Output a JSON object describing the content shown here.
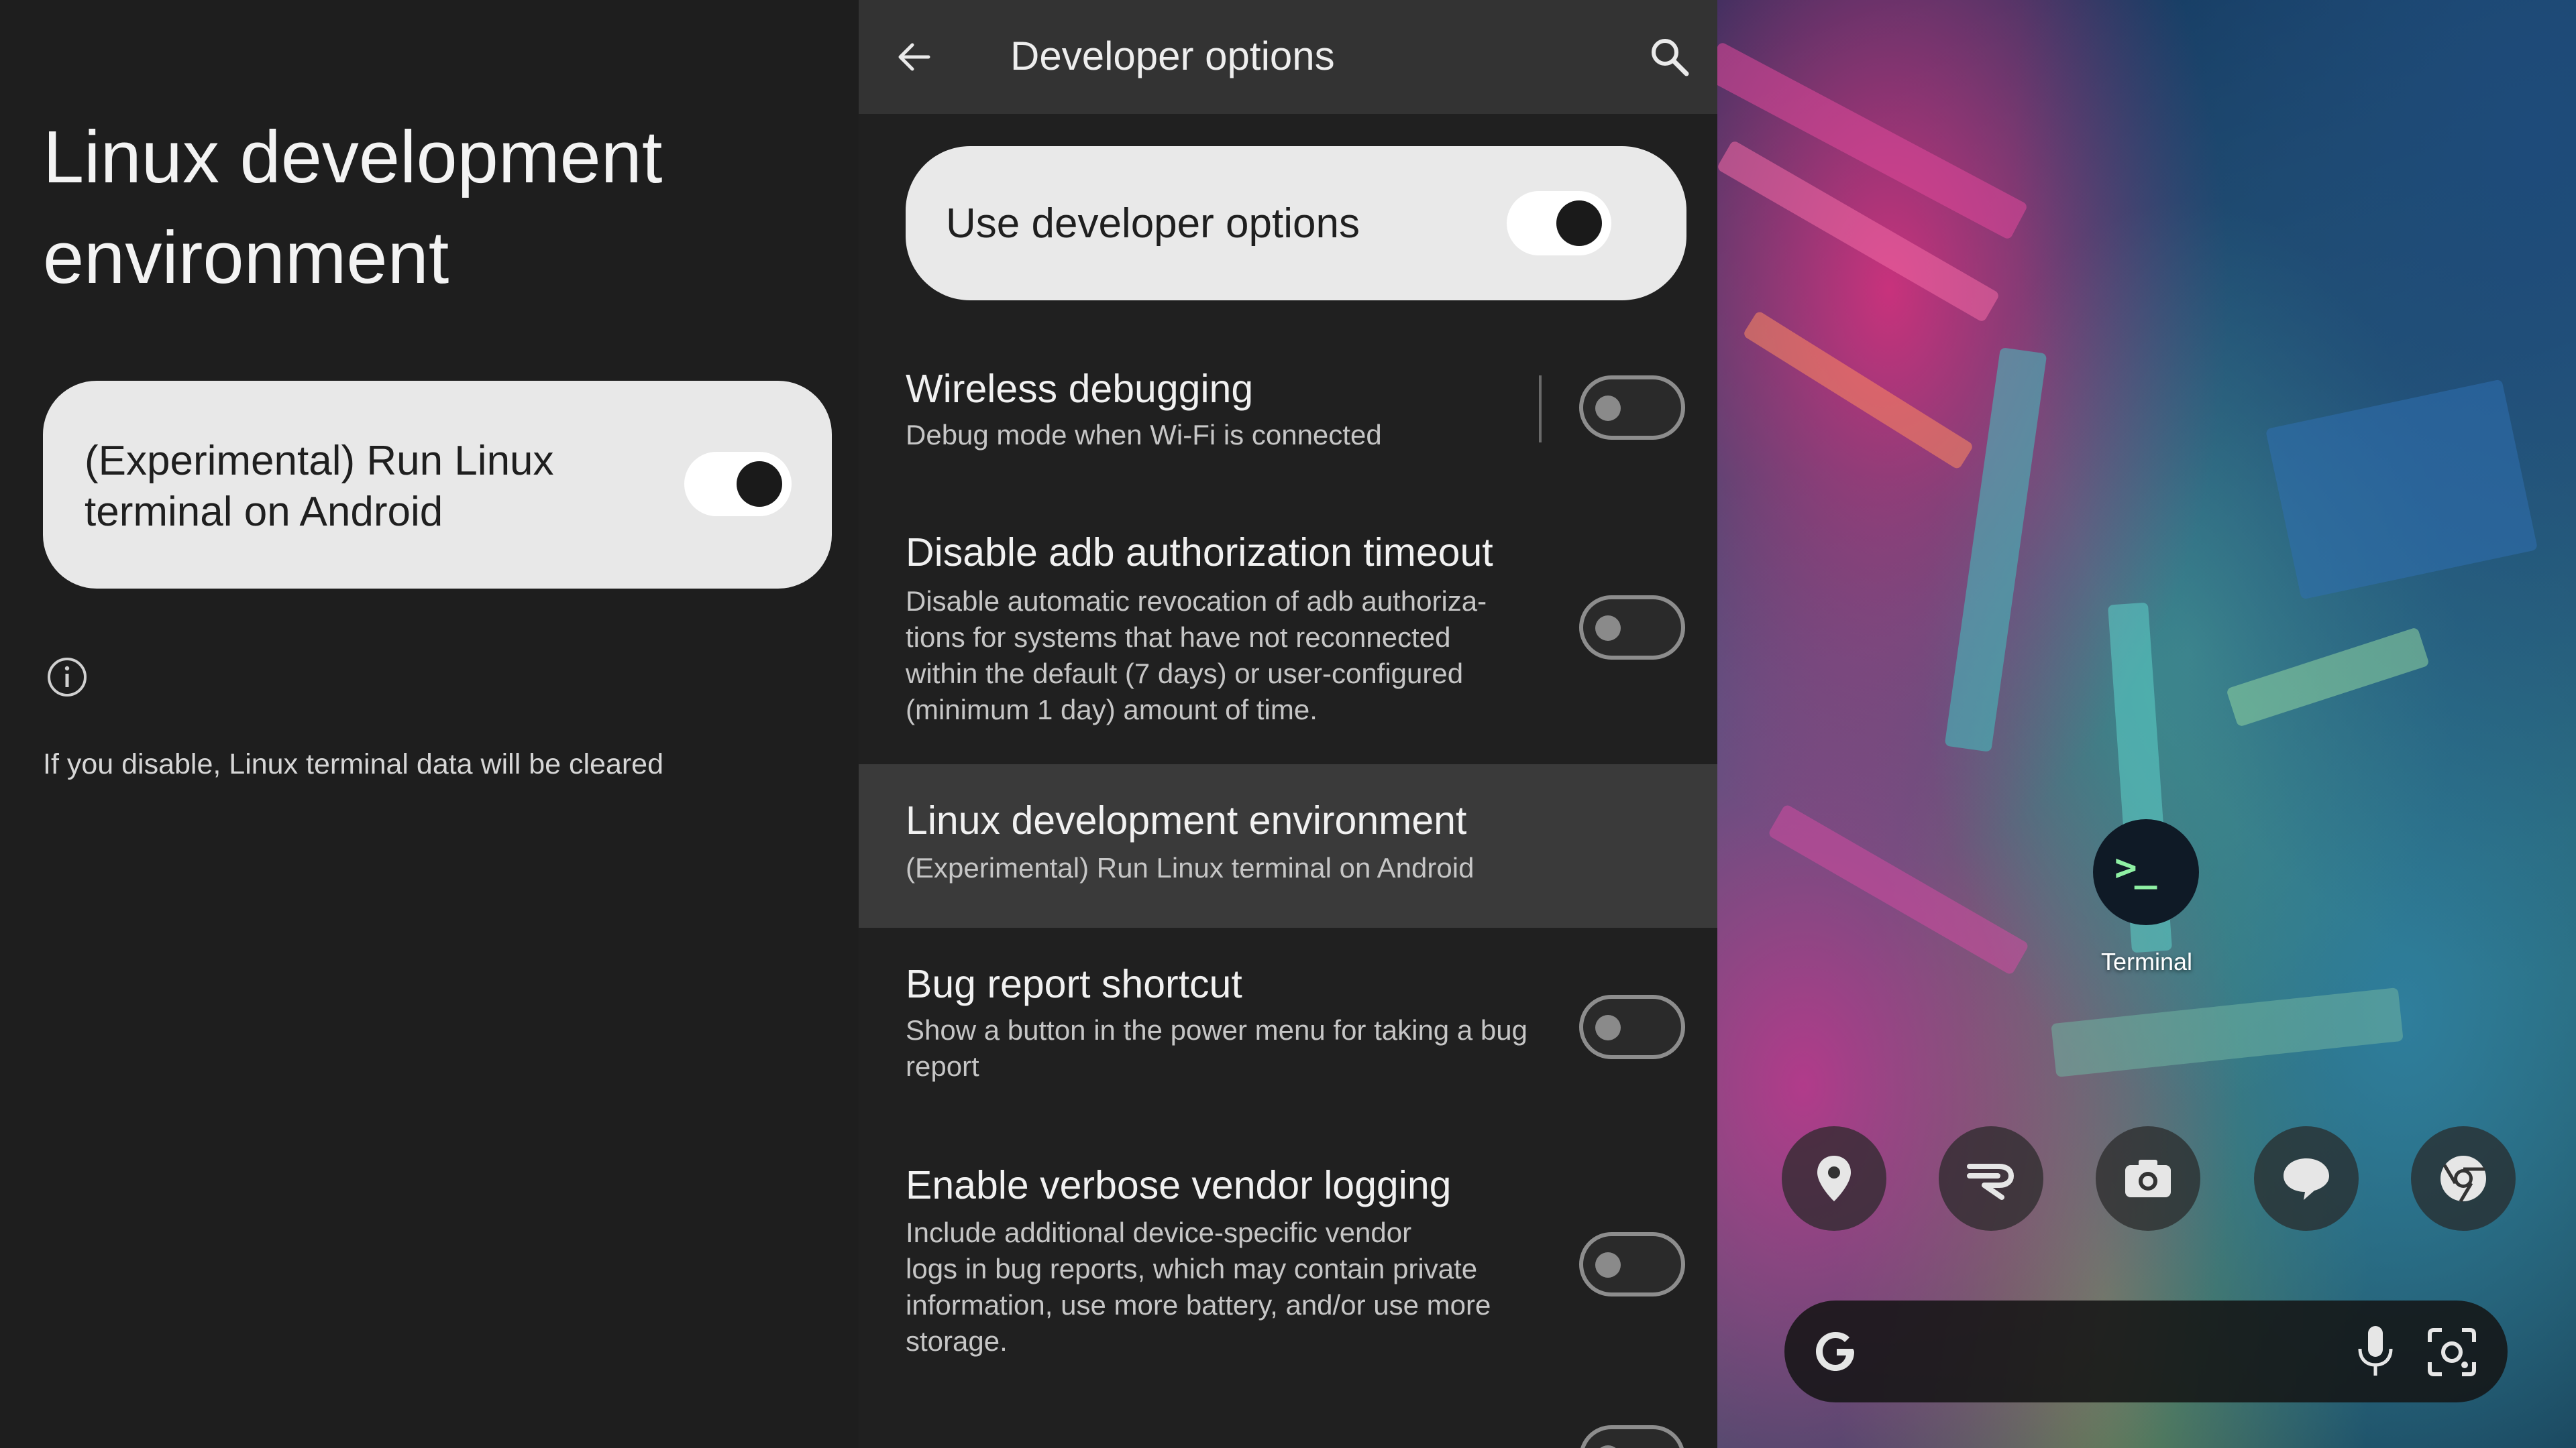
{
  "left": {
    "title": "Linux development environment",
    "toggle_label": "(Experimental) Run Linux terminal on Android",
    "toggle_state": "on",
    "info_icon": "info-icon",
    "note": "If you disable, Linux terminal data will be cleared"
  },
  "middle": {
    "app_bar": {
      "back_icon": "back-arrow-icon",
      "title": "Developer options",
      "search_icon": "search-icon"
    },
    "main_toggle": {
      "label": "Use developer options",
      "state": "on"
    },
    "items": [
      {
        "title": "Wireless debugging",
        "summary": "Debug mode when Wi-Fi is connected",
        "state": "off"
      },
      {
        "title": "Disable adb authorization timeout",
        "summary": "Disable automatic revocation of adb authoriza-\ntions for systems that have not reconnected\nwithin the default (7 days) or user-configured\n(minimum 1 day) amount of time.",
        "state": "off"
      },
      {
        "title": "Linux development environment",
        "summary": "(Experimental) Run Linux terminal on Android"
      },
      {
        "title": "Bug report shortcut",
        "summary": "Show a button in the power menu for taking a bug\nreport",
        "state": "off"
      },
      {
        "title": "Enable verbose vendor logging",
        "summary": "Include additional device-specific vendor\nlogs in bug reports, which may contain private\ninformation, use more battery, and/or use more\nstorage.",
        "state": "off"
      }
    ]
  },
  "right": {
    "terminal_app": {
      "glyph": ">_",
      "label": "Terminal"
    },
    "dock_icons": [
      "maps-icon",
      "app-r-icon",
      "camera-icon",
      "messages-icon",
      "chrome-icon"
    ],
    "search_bar": {
      "google_icon": "google-g-icon",
      "mic_icon": "mic-icon",
      "lens_icon": "lens-icon"
    }
  }
}
